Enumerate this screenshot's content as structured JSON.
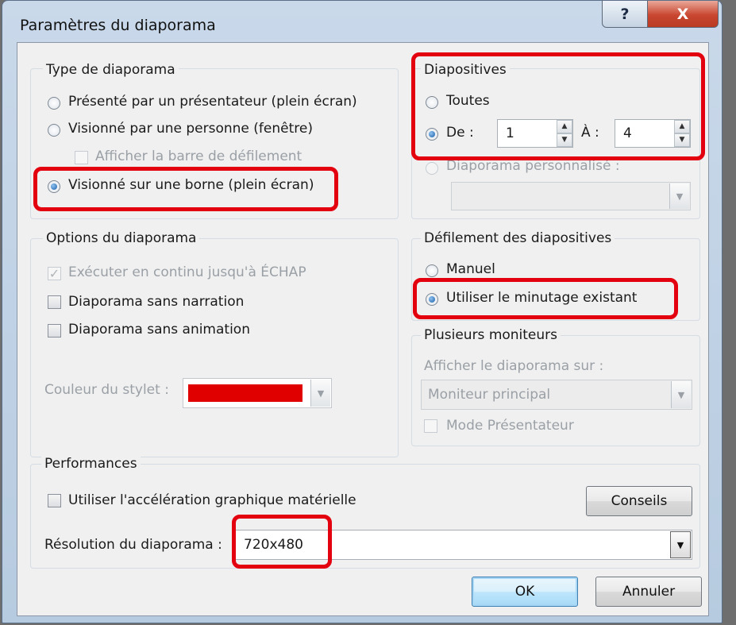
{
  "window": {
    "title": "Paramètres du diaporama",
    "help": "?",
    "close": "X"
  },
  "type_group": {
    "title": "Type de diaporama",
    "opt1": "Présenté par un présentateur (plein écran)",
    "opt2": "Visionné par une personne (fenêtre)",
    "scrollbar": "Afficher la barre de défilement",
    "opt3": "Visionné sur une borne (plein écran)"
  },
  "slides_group": {
    "title": "Diapositives",
    "all": "Toutes",
    "from": "De :",
    "from_value": "1",
    "to": "À :",
    "to_value": "4",
    "custom": "Diaporama personnalisé :"
  },
  "options_group": {
    "title": "Options du diaporama",
    "loop": "Exécuter en continu jusqu'à ÉCHAP",
    "no_narration": "Diaporama sans narration",
    "no_animation": "Diaporama sans animation",
    "pen_color": "Couleur du stylet :",
    "pen_color_value": "#e00000"
  },
  "advance_group": {
    "title": "Défilement des diapositives",
    "manual": "Manuel",
    "timings": "Utiliser le minutage existant"
  },
  "monitors_group": {
    "title": "Plusieurs moniteurs",
    "show_on": "Afficher le diaporama sur :",
    "monitor": "Moniteur principal",
    "presenter": "Mode Présentateur"
  },
  "perf_group": {
    "title": "Performances",
    "hw_accel": "Utiliser l'accélération graphique matérielle",
    "tips": "Conseils",
    "resolution_label": "Résolution du diaporama :",
    "resolution_value": "720x480"
  },
  "buttons": {
    "ok": "OK",
    "cancel": "Annuler"
  },
  "colors": {
    "highlight": "#e3000f",
    "pen": "#e00000"
  }
}
